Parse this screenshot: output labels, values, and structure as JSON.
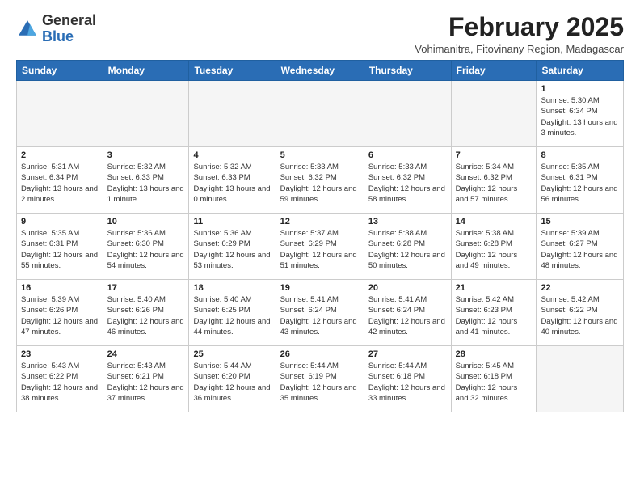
{
  "header": {
    "logo_general": "General",
    "logo_blue": "Blue",
    "month_year": "February 2025",
    "subtitle": "Vohimanitra, Fitovinany Region, Madagascar"
  },
  "weekdays": [
    "Sunday",
    "Monday",
    "Tuesday",
    "Wednesday",
    "Thursday",
    "Friday",
    "Saturday"
  ],
  "weeks": [
    [
      {
        "day": "",
        "info": ""
      },
      {
        "day": "",
        "info": ""
      },
      {
        "day": "",
        "info": ""
      },
      {
        "day": "",
        "info": ""
      },
      {
        "day": "",
        "info": ""
      },
      {
        "day": "",
        "info": ""
      },
      {
        "day": "1",
        "info": "Sunrise: 5:30 AM\nSunset: 6:34 PM\nDaylight: 13 hours and 3 minutes."
      }
    ],
    [
      {
        "day": "2",
        "info": "Sunrise: 5:31 AM\nSunset: 6:34 PM\nDaylight: 13 hours and 2 minutes."
      },
      {
        "day": "3",
        "info": "Sunrise: 5:32 AM\nSunset: 6:33 PM\nDaylight: 13 hours and 1 minute."
      },
      {
        "day": "4",
        "info": "Sunrise: 5:32 AM\nSunset: 6:33 PM\nDaylight: 13 hours and 0 minutes."
      },
      {
        "day": "5",
        "info": "Sunrise: 5:33 AM\nSunset: 6:32 PM\nDaylight: 12 hours and 59 minutes."
      },
      {
        "day": "6",
        "info": "Sunrise: 5:33 AM\nSunset: 6:32 PM\nDaylight: 12 hours and 58 minutes."
      },
      {
        "day": "7",
        "info": "Sunrise: 5:34 AM\nSunset: 6:32 PM\nDaylight: 12 hours and 57 minutes."
      },
      {
        "day": "8",
        "info": "Sunrise: 5:35 AM\nSunset: 6:31 PM\nDaylight: 12 hours and 56 minutes."
      }
    ],
    [
      {
        "day": "9",
        "info": "Sunrise: 5:35 AM\nSunset: 6:31 PM\nDaylight: 12 hours and 55 minutes."
      },
      {
        "day": "10",
        "info": "Sunrise: 5:36 AM\nSunset: 6:30 PM\nDaylight: 12 hours and 54 minutes."
      },
      {
        "day": "11",
        "info": "Sunrise: 5:36 AM\nSunset: 6:29 PM\nDaylight: 12 hours and 53 minutes."
      },
      {
        "day": "12",
        "info": "Sunrise: 5:37 AM\nSunset: 6:29 PM\nDaylight: 12 hours and 51 minutes."
      },
      {
        "day": "13",
        "info": "Sunrise: 5:38 AM\nSunset: 6:28 PM\nDaylight: 12 hours and 50 minutes."
      },
      {
        "day": "14",
        "info": "Sunrise: 5:38 AM\nSunset: 6:28 PM\nDaylight: 12 hours and 49 minutes."
      },
      {
        "day": "15",
        "info": "Sunrise: 5:39 AM\nSunset: 6:27 PM\nDaylight: 12 hours and 48 minutes."
      }
    ],
    [
      {
        "day": "16",
        "info": "Sunrise: 5:39 AM\nSunset: 6:26 PM\nDaylight: 12 hours and 47 minutes."
      },
      {
        "day": "17",
        "info": "Sunrise: 5:40 AM\nSunset: 6:26 PM\nDaylight: 12 hours and 46 minutes."
      },
      {
        "day": "18",
        "info": "Sunrise: 5:40 AM\nSunset: 6:25 PM\nDaylight: 12 hours and 44 minutes."
      },
      {
        "day": "19",
        "info": "Sunrise: 5:41 AM\nSunset: 6:24 PM\nDaylight: 12 hours and 43 minutes."
      },
      {
        "day": "20",
        "info": "Sunrise: 5:41 AM\nSunset: 6:24 PM\nDaylight: 12 hours and 42 minutes."
      },
      {
        "day": "21",
        "info": "Sunrise: 5:42 AM\nSunset: 6:23 PM\nDaylight: 12 hours and 41 minutes."
      },
      {
        "day": "22",
        "info": "Sunrise: 5:42 AM\nSunset: 6:22 PM\nDaylight: 12 hours and 40 minutes."
      }
    ],
    [
      {
        "day": "23",
        "info": "Sunrise: 5:43 AM\nSunset: 6:22 PM\nDaylight: 12 hours and 38 minutes."
      },
      {
        "day": "24",
        "info": "Sunrise: 5:43 AM\nSunset: 6:21 PM\nDaylight: 12 hours and 37 minutes."
      },
      {
        "day": "25",
        "info": "Sunrise: 5:44 AM\nSunset: 6:20 PM\nDaylight: 12 hours and 36 minutes."
      },
      {
        "day": "26",
        "info": "Sunrise: 5:44 AM\nSunset: 6:19 PM\nDaylight: 12 hours and 35 minutes."
      },
      {
        "day": "27",
        "info": "Sunrise: 5:44 AM\nSunset: 6:18 PM\nDaylight: 12 hours and 33 minutes."
      },
      {
        "day": "28",
        "info": "Sunrise: 5:45 AM\nSunset: 6:18 PM\nDaylight: 12 hours and 32 minutes."
      },
      {
        "day": "",
        "info": ""
      }
    ]
  ]
}
